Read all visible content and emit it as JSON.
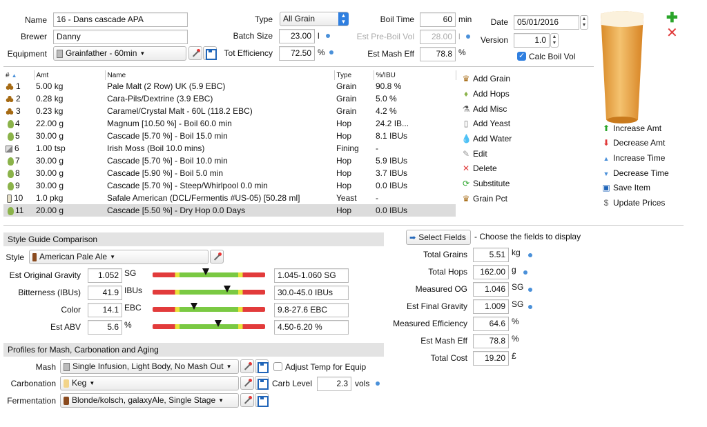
{
  "header": {
    "name_label": "Name",
    "name_value": "16 - Dans cascade APA",
    "brewer_label": "Brewer",
    "brewer_value": "Danny",
    "equipment_label": "Equipment",
    "equipment_value": "Grainfather - 60min",
    "type_label": "Type",
    "type_value": "All Grain",
    "batch_label": "Batch Size",
    "batch_value": "23.00",
    "batch_unit": "l",
    "efficiency_label": "Tot Efficiency",
    "efficiency_value": "72.50",
    "efficiency_unit": "%",
    "boil_time_label": "Boil Time",
    "boil_time_value": "60",
    "boil_time_unit": "min",
    "preboil_label": "Est Pre-Boil Vol",
    "preboil_value": "28.00",
    "preboil_unit": "l",
    "mash_eff_label": "Est Mash Eff",
    "mash_eff_value": "78.8",
    "mash_eff_unit": "%",
    "date_label": "Date",
    "date_value": "05/01/2016",
    "version_label": "Version",
    "version_value": "1.0",
    "calc_boil_label": "Calc Boil Vol",
    "calc_boil_checked": true
  },
  "table": {
    "columns": [
      "#",
      "Amt",
      "Name",
      "Type",
      "%/IBU"
    ],
    "rows": [
      {
        "num": "1",
        "icon": "grain-icon",
        "amt": "5.00 kg",
        "name": "Pale Malt (2 Row) UK (5.9 EBC)",
        "type": "Grain",
        "pct": "90.8 %"
      },
      {
        "num": "2",
        "icon": "grain-icon",
        "amt": "0.28 kg",
        "name": "Cara-Pils/Dextrine (3.9 EBC)",
        "type": "Grain",
        "pct": "5.0 %"
      },
      {
        "num": "3",
        "icon": "grain-icon",
        "amt": "0.23 kg",
        "name": "Caramel/Crystal Malt - 60L (118.2 EBC)",
        "type": "Grain",
        "pct": "4.2 %"
      },
      {
        "num": "4",
        "icon": "hop-icon",
        "amt": "22.00 g",
        "name": "Magnum [10.50 %] - Boil 60.0 min",
        "type": "Hop",
        "pct": "24.2 IB..."
      },
      {
        "num": "5",
        "icon": "hop-icon",
        "amt": "30.00 g",
        "name": "Cascade [5.70 %] - Boil 15.0 min",
        "type": "Hop",
        "pct": "8.1 IBUs"
      },
      {
        "num": "6",
        "icon": "misc-icon",
        "amt": "1.00 tsp",
        "name": "Irish Moss (Boil 10.0 mins)",
        "type": "Fining",
        "pct": "-"
      },
      {
        "num": "7",
        "icon": "hop-icon",
        "amt": "30.00 g",
        "name": "Cascade [5.70 %] - Boil 10.0 min",
        "type": "Hop",
        "pct": "5.9 IBUs"
      },
      {
        "num": "8",
        "icon": "hop-icon",
        "amt": "30.00 g",
        "name": "Cascade [5.90 %] - Boil 5.0 min",
        "type": "Hop",
        "pct": "3.7 IBUs"
      },
      {
        "num": "9",
        "icon": "hop-icon",
        "amt": "30.00 g",
        "name": "Cascade [5.70 %] - Steep/Whirlpool  0.0 min",
        "type": "Hop",
        "pct": "0.0 IBUs"
      },
      {
        "num": "10",
        "icon": "yeast-icon",
        "amt": "1.0 pkg",
        "name": "Safale American  (DCL/Fermentis #US-05) [50.28 ml]",
        "type": "Yeast",
        "pct": "-"
      },
      {
        "num": "11",
        "icon": "hop-icon",
        "amt": "20.00 g",
        "name": "Cascade [5.50 %] - Dry Hop 0.0 Days",
        "type": "Hop",
        "pct": "0.0 IBUs"
      }
    ]
  },
  "actions": {
    "add_grain": "Add Grain",
    "add_hops": "Add Hops",
    "add_misc": "Add Misc",
    "add_yeast": "Add Yeast",
    "add_water": "Add Water",
    "edit": "Edit",
    "delete": "Delete",
    "substitute": "Substitute",
    "grain_pct": "Grain Pct"
  },
  "side": {
    "increase_amt": "Increase Amt",
    "decrease_amt": "Decrease Amt",
    "increase_time": "Increase Time",
    "decrease_time": "Decrease Time",
    "save_item": "Save Item",
    "update_prices": "Update Prices"
  },
  "style_guide": {
    "title": "Style Guide Comparison",
    "style_label": "Style",
    "style_value": "American Pale Ale",
    "rows": [
      {
        "label": "Est Original Gravity",
        "value": "1.052",
        "unit": "SG",
        "range": "1.045-1.060 SG",
        "level": 0.47
      },
      {
        "label": "Bitterness (IBUs)",
        "value": "41.9",
        "unit": "IBUs",
        "range": "30.0-45.0 IBUs",
        "level": 0.66
      },
      {
        "label": "Color",
        "value": "14.1",
        "unit": "EBC",
        "range": "9.8-27.6 EBC",
        "level": 0.37
      },
      {
        "label": "Est ABV",
        "value": "5.6",
        "unit": "%",
        "range": "4.50-6.20 %",
        "level": 0.58
      }
    ]
  },
  "profiles": {
    "title": "Profiles for Mash, Carbonation and Aging",
    "mash_label": "Mash",
    "mash_value": "Single Infusion, Light Body, No Mash Out",
    "adjust_label": "Adjust Temp for Equip",
    "carb_label": "Carbonation",
    "carb_value": "Keg",
    "carb_level_label": "Carb Level",
    "carb_level_value": "2.3",
    "carb_level_unit": "vols",
    "ferm_label": "Fermentation",
    "ferm_value": "Blonde/kolsch, galaxyAle, Single Stage"
  },
  "fields": {
    "select_button": "Select Fields",
    "hint": "- Choose the fields to display",
    "rows": [
      {
        "label": "Total Grains",
        "value": "5.51",
        "unit": "kg",
        "dot": true
      },
      {
        "label": "Total Hops",
        "value": "162.00",
        "unit": "g",
        "dot": true
      },
      {
        "label": "Measured OG",
        "value": "1.046",
        "unit": "SG",
        "dot": true
      },
      {
        "label": "Est Final Gravity",
        "value": "1.009",
        "unit": "SG",
        "dot": true
      },
      {
        "label": "Measured Efficiency",
        "value": "64.6",
        "unit": "%",
        "dot": false
      },
      {
        "label": "Est Mash Eff",
        "value": "78.8",
        "unit": "%",
        "dot": false
      },
      {
        "label": "Total Cost",
        "value": "19.20",
        "unit": "£",
        "dot": false
      }
    ]
  },
  "colors": {
    "accent": "#4a90d9",
    "add_green": "#2aa52a",
    "delete_red": "#e03a3a",
    "beer": "#e9a54a"
  }
}
